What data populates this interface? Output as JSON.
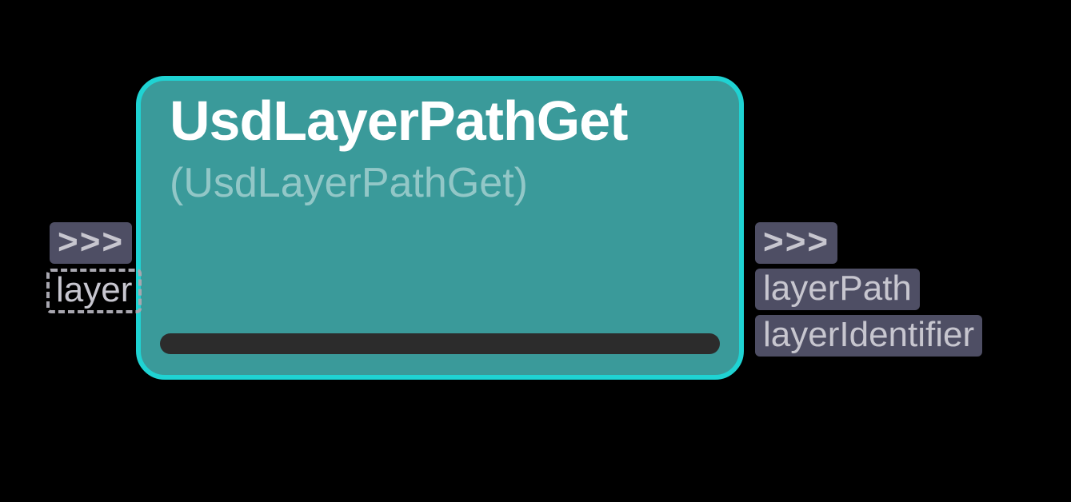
{
  "node": {
    "title": "UsdLayerPathGet",
    "subtitle": "(UsdLayerPathGet)"
  },
  "inputs": {
    "flow": ">>>",
    "layer": "layer"
  },
  "outputs": {
    "flow": ">>>",
    "layerPath": "layerPath",
    "layerIdentifier": "layerIdentifier"
  }
}
